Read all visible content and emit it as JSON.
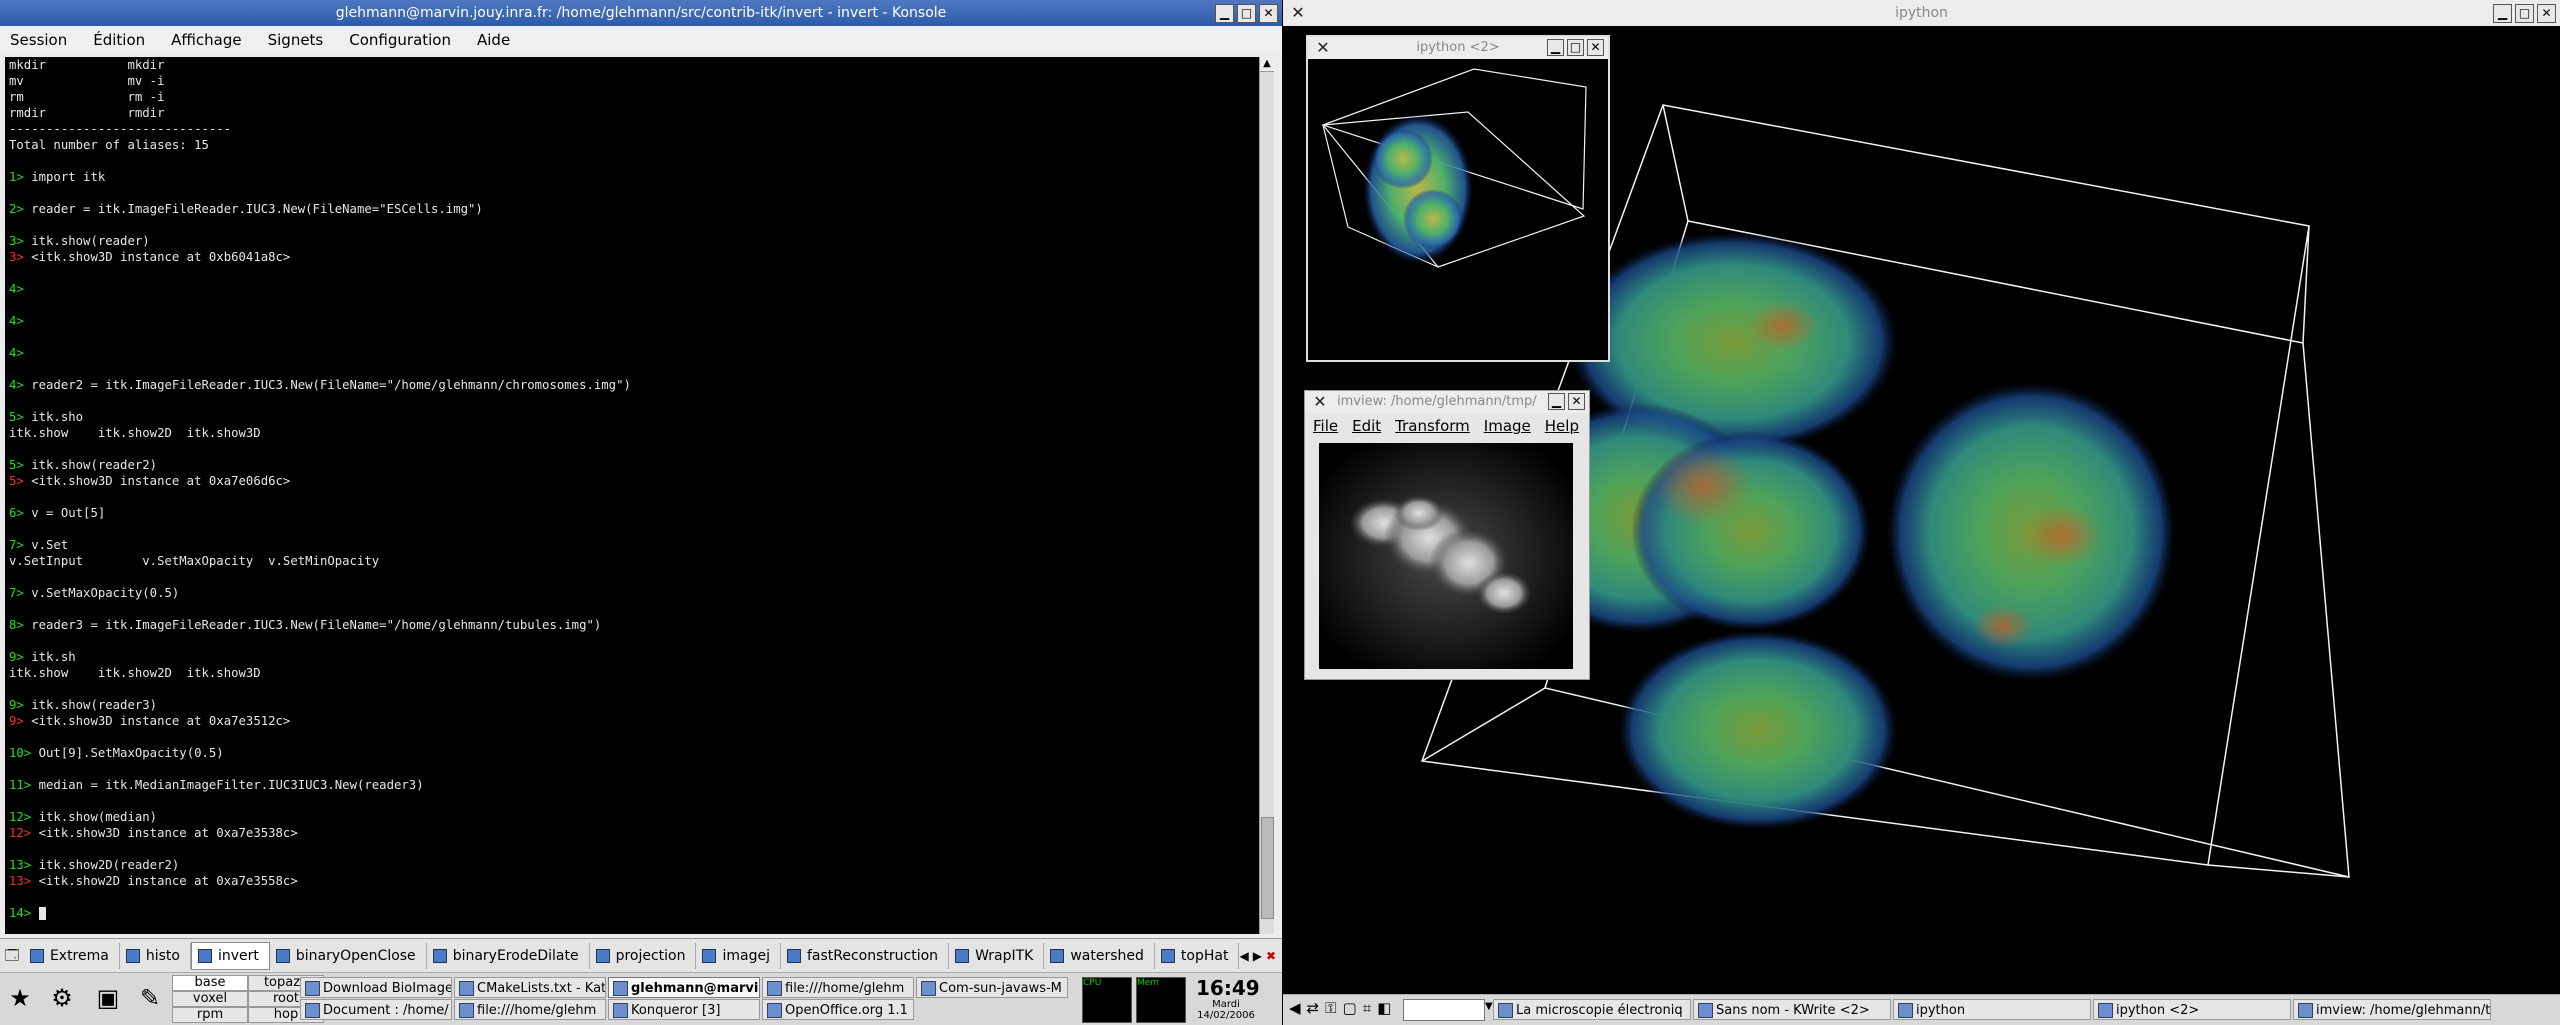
{
  "konsole": {
    "title": "glehmann@marvin.jouy.inra.fr: /home/glehmann/src/contrib-itk/invert - invert - Konsole",
    "menu": [
      "Session",
      "Édition",
      "Affichage",
      "Signets",
      "Configuration",
      "Aide"
    ],
    "lines": [
      {
        "t": "mkdir           mkdir",
        "c": ""
      },
      {
        "t": "mv              mv -i",
        "c": ""
      },
      {
        "t": "rm              rm -i",
        "c": ""
      },
      {
        "t": "rmdir           rmdir",
        "c": ""
      },
      {
        "t": "------------------------------",
        "c": ""
      },
      {
        "t": "Total number of aliases: 15",
        "c": ""
      },
      {
        "t": "",
        "c": ""
      },
      {
        "p": "1>",
        "t": " import itk",
        "c": "p"
      },
      {
        "t": "",
        "c": ""
      },
      {
        "p": "2>",
        "t": " reader = itk.ImageFileReader.IUC3.New(FileName=\"ESCells.img\")",
        "c": "p"
      },
      {
        "t": "",
        "c": ""
      },
      {
        "p": "3>",
        "t": " itk.show(reader)",
        "c": "p"
      },
      {
        "p": "3>",
        "t": " <itk.show3D instance at 0xb6041a8c>",
        "c": "o"
      },
      {
        "t": "",
        "c": ""
      },
      {
        "p": "4>",
        "t": "",
        "c": "p"
      },
      {
        "t": "",
        "c": ""
      },
      {
        "p": "4>",
        "t": "",
        "c": "p"
      },
      {
        "t": "",
        "c": ""
      },
      {
        "p": "4>",
        "t": "",
        "c": "p"
      },
      {
        "t": "",
        "c": ""
      },
      {
        "p": "4>",
        "t": " reader2 = itk.ImageFileReader.IUC3.New(FileName=\"/home/glehmann/chromosomes.img\")",
        "c": "p"
      },
      {
        "t": "",
        "c": ""
      },
      {
        "p": "5>",
        "t": " itk.sho",
        "c": "p"
      },
      {
        "t": "itk.show    itk.show2D  itk.show3D",
        "c": ""
      },
      {
        "t": "",
        "c": ""
      },
      {
        "p": "5>",
        "t": " itk.show(reader2)",
        "c": "p"
      },
      {
        "p": "5>",
        "t": " <itk.show3D instance at 0xa7e06d6c>",
        "c": "o"
      },
      {
        "t": "",
        "c": ""
      },
      {
        "p": "6>",
        "t": " v = Out[5]",
        "c": "p"
      },
      {
        "t": "",
        "c": ""
      },
      {
        "p": "7>",
        "t": " v.Set",
        "c": "p"
      },
      {
        "t": "v.SetInput        v.SetMaxOpacity  v.SetMinOpacity",
        "c": ""
      },
      {
        "t": "",
        "c": ""
      },
      {
        "p": "7>",
        "t": " v.SetMaxOpacity(0.5)",
        "c": "p"
      },
      {
        "t": "",
        "c": ""
      },
      {
        "p": "8>",
        "t": " reader3 = itk.ImageFileReader.IUC3.New(FileName=\"/home/glehmann/tubules.img\")",
        "c": "p"
      },
      {
        "t": "",
        "c": ""
      },
      {
        "p": "9>",
        "t": " itk.sh",
        "c": "p"
      },
      {
        "t": "itk.show    itk.show2D  itk.show3D",
        "c": ""
      },
      {
        "t": "",
        "c": ""
      },
      {
        "p": "9>",
        "t": " itk.show(reader3)",
        "c": "p"
      },
      {
        "p": "9>",
        "t": " <itk.show3D instance at 0xa7e3512c>",
        "c": "o"
      },
      {
        "t": "",
        "c": ""
      },
      {
        "p": "10>",
        "t": " Out[9].SetMaxOpacity(0.5)",
        "c": "p"
      },
      {
        "t": "",
        "c": ""
      },
      {
        "p": "11>",
        "t": " median = itk.MedianImageFilter.IUC3IUC3.New(reader3)",
        "c": "p"
      },
      {
        "t": "",
        "c": ""
      },
      {
        "p": "12>",
        "t": " itk.show(median)",
        "c": "p"
      },
      {
        "p": "12>",
        "t": " <itk.show3D instance at 0xa7e3538c>",
        "c": "o"
      },
      {
        "t": "",
        "c": ""
      },
      {
        "p": "13>",
        "t": " itk.show2D(reader2)",
        "c": "p"
      },
      {
        "p": "13>",
        "t": " <itk.show2D instance at 0xa7e3558c>",
        "c": "o"
      },
      {
        "t": "",
        "c": ""
      },
      {
        "p": "14>",
        "t": " ",
        "c": "p"
      }
    ],
    "tabs": [
      "Extrema",
      "histo",
      "invert",
      "binaryOpenClose",
      "binaryErodeDilate",
      "projection",
      "imagej",
      "fastReconstruction",
      "WrapITK",
      "watershed",
      "topHat"
    ],
    "active_tab": "invert"
  },
  "ipython": {
    "title": "ipython",
    "small_title": "ipython <2>"
  },
  "imview": {
    "title": "imview: /home/glehmann/tmp/",
    "menu": [
      "File",
      "Edit",
      "Transform",
      "Image",
      "Help"
    ]
  },
  "taskbar": {
    "desktops": [
      "base",
      "topaze",
      "voxel",
      "root",
      "rpm",
      "hop"
    ],
    "active_desktop": "base",
    "tasks_row1": [
      "Download BioImage",
      "CMakeLists.txt - Kat",
      "glehmann@marvi",
      "file:///home/glehm",
      "Com-sun-javaws-M"
    ],
    "tasks_row2": [
      "Document : /home/",
      "file:///home/glehm",
      "Konqueror [3]",
      "OpenOffice.org 1.1"
    ],
    "active_task": "glehmann@marvi",
    "meters": [
      "CPU",
      "Mem"
    ],
    "clock_time": "16:49",
    "clock_day": "Mardi",
    "clock_date": "14/02/2006",
    "right_tasks": [
      "La microscopie électroniq",
      "Sans nom - KWrite <2>",
      "ipython",
      "ipython <2>",
      "imview: /home/glehmann/t"
    ]
  },
  "colors": {
    "prompt": "#19e619",
    "output": "#ff2a2a",
    "term_bg": "#000000",
    "kde_title": "#2f5aa6"
  }
}
